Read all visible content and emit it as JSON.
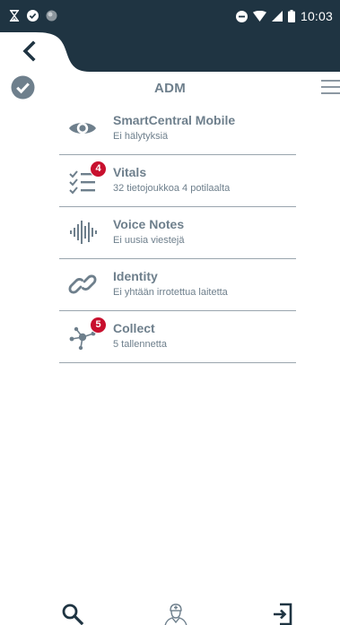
{
  "status_bar": {
    "time": "10:03"
  },
  "header": {
    "title": "ADM"
  },
  "services": [
    {
      "title": "SmartCentral Mobile",
      "subtitle": "Ei hälytyksiä",
      "icon": "eye-icon"
    },
    {
      "title": "Vitals",
      "subtitle": "32 tietojoukkoa 4 potilaalta",
      "icon": "checklist-icon",
      "badge": "4"
    },
    {
      "title": "Voice Notes",
      "subtitle": "Ei uusia viestejä",
      "icon": "waveform-icon"
    },
    {
      "title": "Identity",
      "subtitle": "Ei yhtään irrotettua laitetta",
      "icon": "link-icon"
    },
    {
      "title": "Collect",
      "subtitle": "5 tallennetta",
      "icon": "network-icon",
      "badge": "5"
    }
  ],
  "bottom_bar": {
    "items": [
      "search-icon",
      "nurse-profile-icon",
      "login-icon"
    ]
  },
  "colors": {
    "header_dark": "#1f3442",
    "text_gray": "#6e7f8c",
    "badge_red": "#c8102e",
    "divider": "#9aa5ae"
  }
}
